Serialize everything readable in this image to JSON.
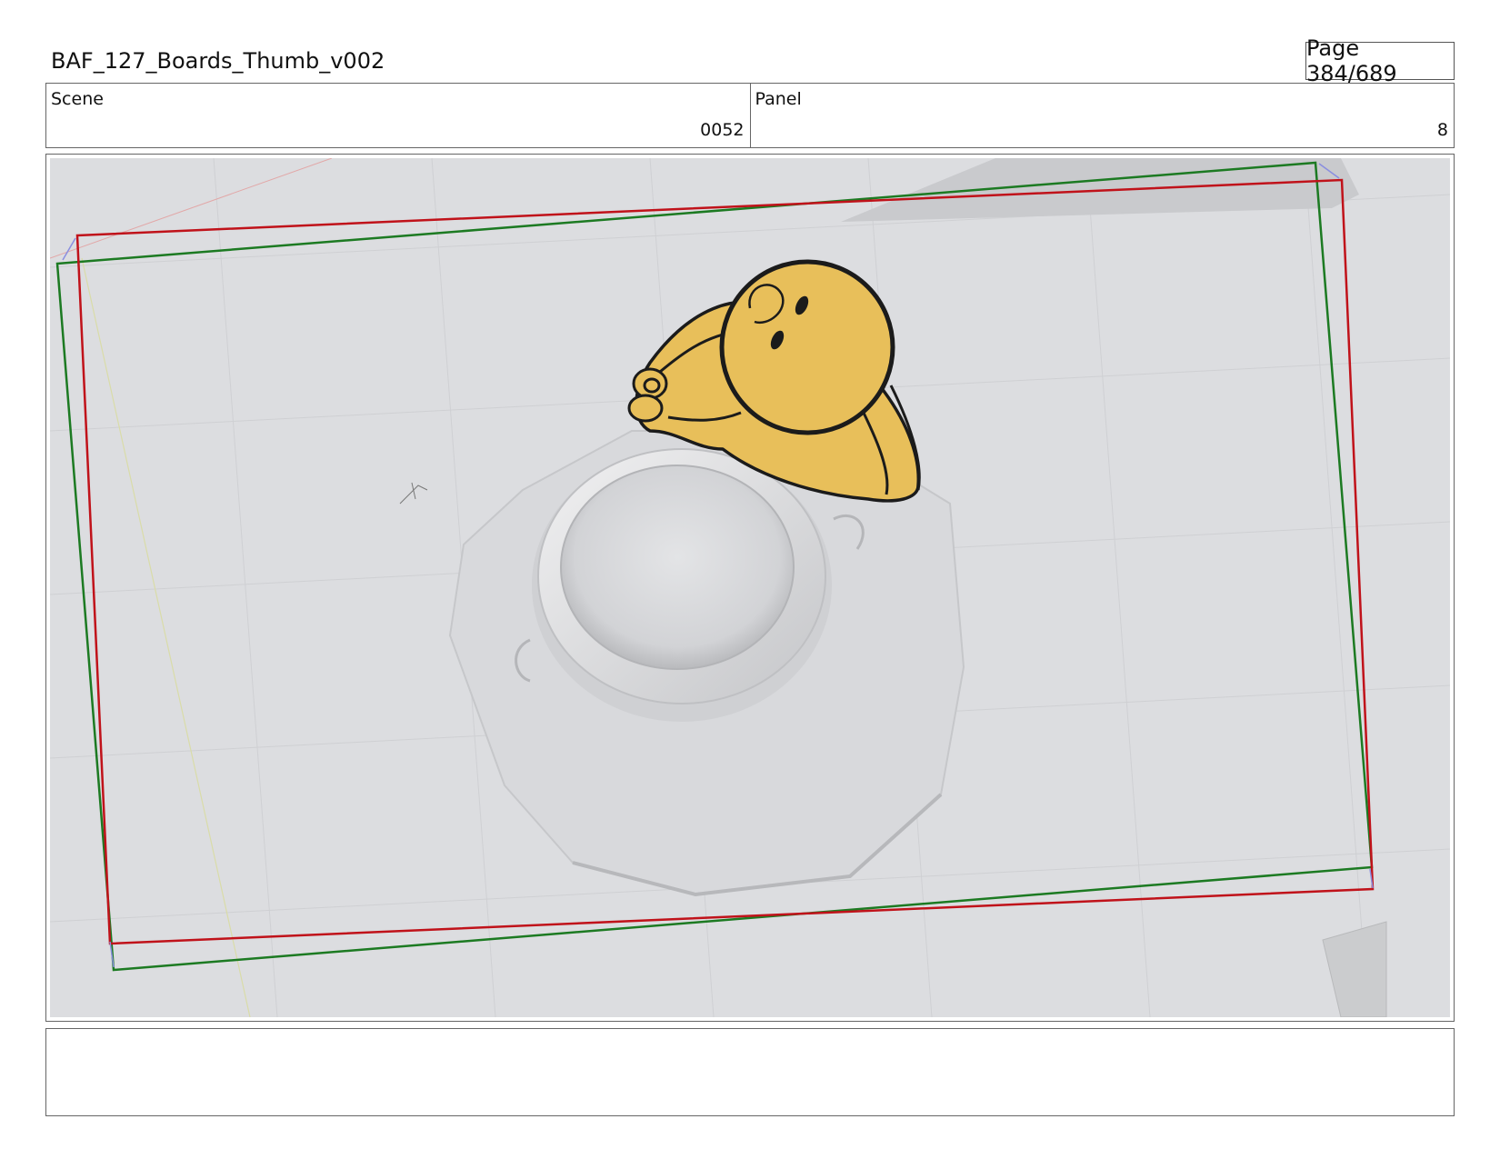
{
  "header": {
    "title": "BAF_127_Boards_Thumb_v002",
    "page_label": "Page 384/689"
  },
  "scene": {
    "label": "Scene",
    "value": "0052"
  },
  "panel": {
    "label": "Panel",
    "value": "8"
  },
  "notes": {
    "text": ""
  },
  "colors": {
    "viewport_bg": "#dcdde0",
    "frame_red": "#c0121a",
    "frame_green": "#1c7a22",
    "character_fill": "#e8bf5a"
  }
}
